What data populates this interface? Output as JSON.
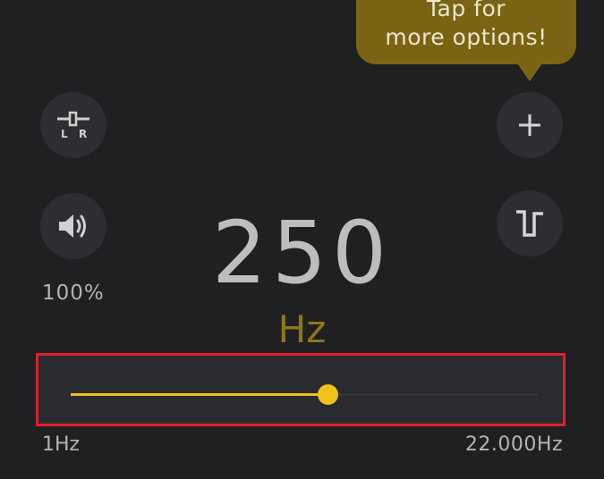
{
  "tooltip": {
    "line1": "Tap for",
    "line2": "more options!"
  },
  "balance_button": {
    "left_label": "L",
    "right_label": "R",
    "icon": "balance-slider-icon"
  },
  "volume": {
    "icon": "speaker-icon",
    "label": "100%"
  },
  "add_button": {
    "icon": "plus-icon"
  },
  "waveform_button": {
    "icon": "square-wave-icon"
  },
  "frequency": {
    "value": "250",
    "unit": "Hz"
  },
  "slider": {
    "min_label": "1Hz",
    "max_label": "22.000Hz",
    "position_fraction": 0.55
  },
  "colors": {
    "background": "#1f2022",
    "accent": "#f2c21a",
    "tooltip": "#7a6414",
    "unit": "#8f7616",
    "highlight": "#e0202a"
  }
}
